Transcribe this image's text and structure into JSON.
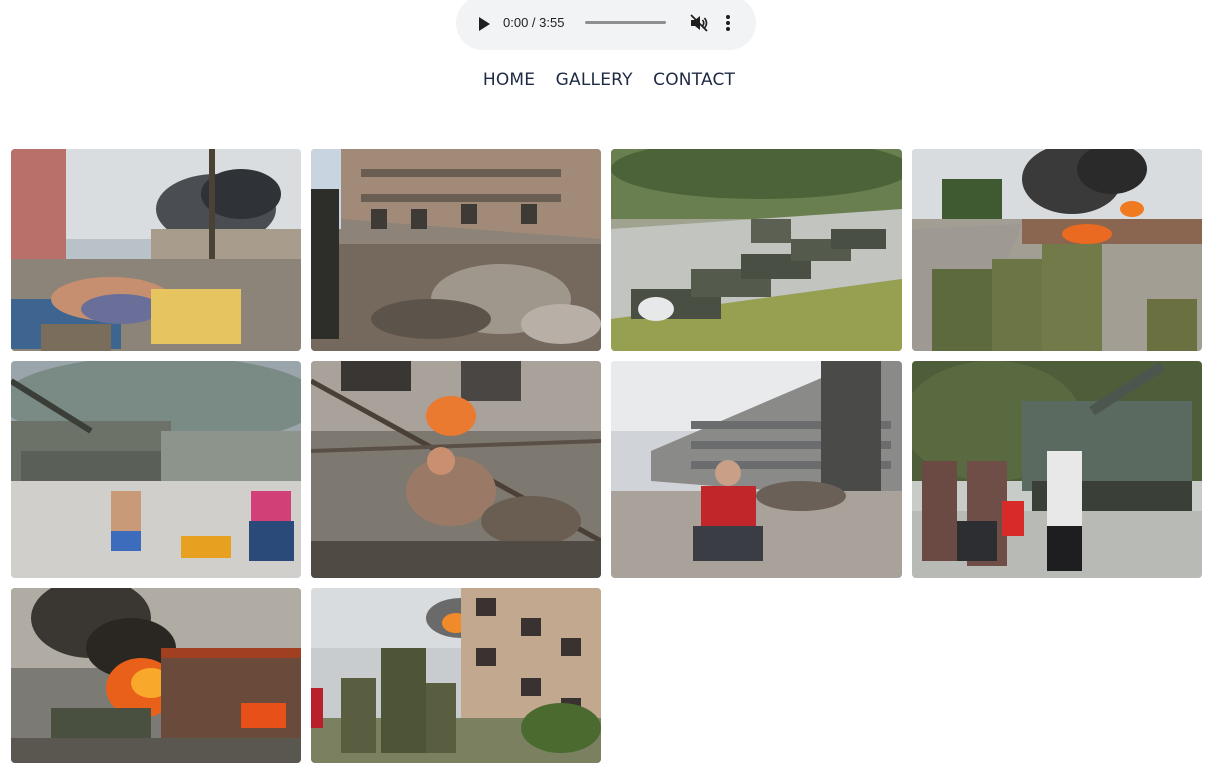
{
  "audio": {
    "time_display": "0:00 / 3:55",
    "progress": 0,
    "muted": true,
    "icons": [
      "play-icon",
      "muted-speaker-icon",
      "more-vert-icon"
    ]
  },
  "nav": {
    "items": [
      "HOME",
      "GALLERY",
      "CONTACT"
    ]
  },
  "gallery": {
    "photo_count": 10
  }
}
